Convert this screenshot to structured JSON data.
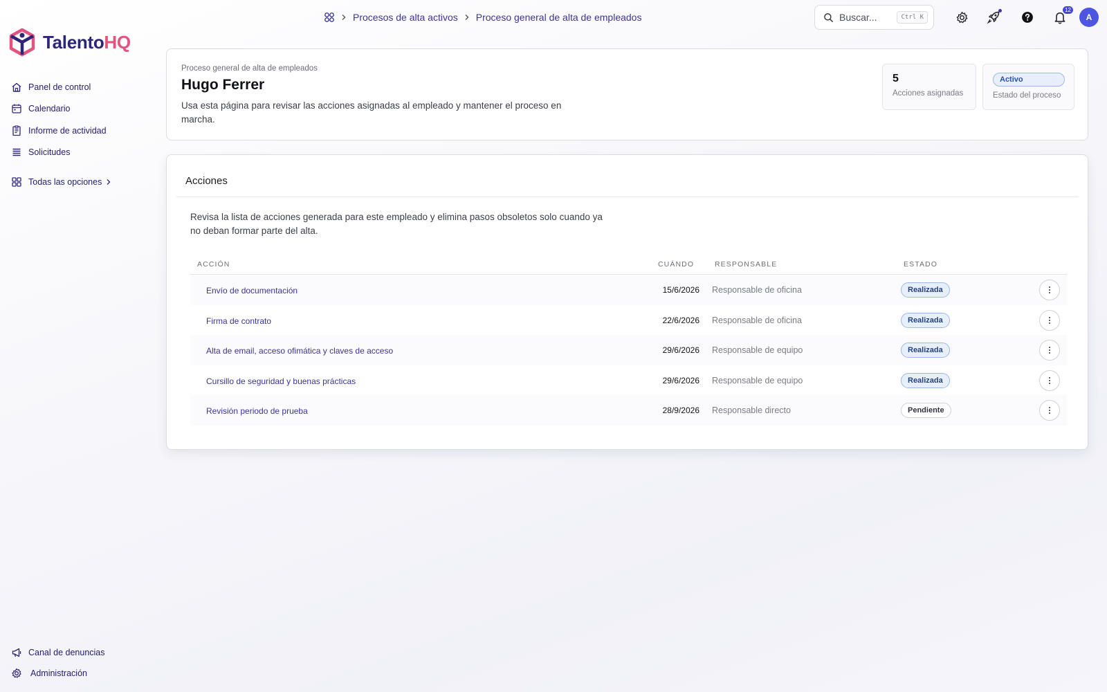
{
  "app": {
    "name_part1": "Talento",
    "name_part2": "HQ"
  },
  "colors": {
    "brand_dark": "#2c2679",
    "brand_pink": "#e2537e",
    "accent": "#4e55e3"
  },
  "sidebar": {
    "items": [
      {
        "label": "Panel de control",
        "icon": "home-icon"
      },
      {
        "label": "Calendario",
        "icon": "calendar-icon"
      },
      {
        "label": "Informe de actividad",
        "icon": "report-icon"
      },
      {
        "label": "Solicitudes",
        "icon": "list-icon"
      }
    ],
    "all_options": {
      "label": "Todas las opciones",
      "icon": "grid-icon"
    },
    "bottom": [
      {
        "label": "Canal de denuncias",
        "icon": "megaphone-icon"
      },
      {
        "label": "Administración",
        "icon": "gear-icon"
      }
    ]
  },
  "breadcrumb": {
    "home_icon": "apps-icon",
    "items": [
      "Procesos de alta activos",
      "Proceso general de alta de empleados"
    ]
  },
  "search": {
    "placeholder": "Buscar...",
    "shortcut": "Ctrl K"
  },
  "topbar": {
    "notifications_count": "12",
    "avatar_initial": "A"
  },
  "header": {
    "eyebrow": "Proceso general de alta de empleados",
    "name": "Hugo Ferrer",
    "description": "Usa esta página para revisar las acciones asignadas al empleado y mantener el proceso en marcha.",
    "stats": {
      "assigned_count": "5",
      "assigned_label": "Acciones asignadas",
      "status_value": "Activo",
      "status_label": "Estado del proceso"
    }
  },
  "actions": {
    "title": "Acciones",
    "description": "Revisa la lista de acciones generada para este empleado y elimina pasos obsoletos solo cuando ya no deban formar parte del alta.",
    "columns": {
      "action": "ACCIÓN",
      "when": "CUÁNDO",
      "owner": "RESPONSABLE",
      "status": "ESTADO"
    },
    "rows": [
      {
        "action": "Envío de documentación",
        "when": "15/6/2026",
        "owner": "Responsable de oficina",
        "status": "Realizada",
        "status_kind": "done"
      },
      {
        "action": "Firma de contrato",
        "when": "22/6/2026",
        "owner": "Responsable de oficina",
        "status": "Realizada",
        "status_kind": "done"
      },
      {
        "action": "Alta de email, acceso ofimática y claves de acceso",
        "when": "29/6/2026",
        "owner": "Responsable de equipo",
        "status": "Realizada",
        "status_kind": "done"
      },
      {
        "action": "Cursillo de seguridad y buenas prácticas",
        "when": "29/6/2026",
        "owner": "Responsable de equipo",
        "status": "Realizada",
        "status_kind": "done"
      },
      {
        "action": "Revisión periodo de prueba",
        "when": "28/9/2026",
        "owner": "Responsable directo",
        "status": "Pendiente",
        "status_kind": "pending"
      }
    ]
  }
}
